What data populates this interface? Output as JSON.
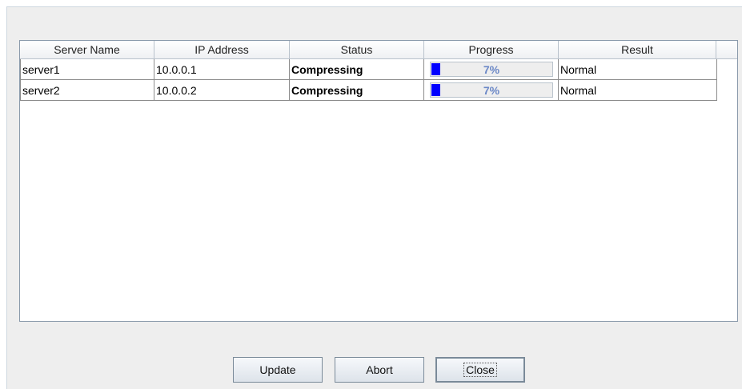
{
  "table": {
    "columns": [
      "Server Name",
      "IP Address",
      "Status",
      "Progress",
      "Result"
    ],
    "rows": [
      {
        "server_name": "server1",
        "ip_address": "10.0.0.1",
        "status": "Compressing",
        "progress_value": 0.07,
        "progress_label": "7%",
        "result": "Normal"
      },
      {
        "server_name": "server2",
        "ip_address": "10.0.0.2",
        "status": "Compressing",
        "progress_value": 0.07,
        "progress_label": "7%",
        "result": "Normal"
      }
    ]
  },
  "buttons": {
    "update": "Update",
    "abort": "Abort",
    "close": "Close"
  },
  "colors": {
    "progress_fill": "#0000ff",
    "progress_text": "#6b88c7",
    "dialog_background": "#eeeeee"
  }
}
